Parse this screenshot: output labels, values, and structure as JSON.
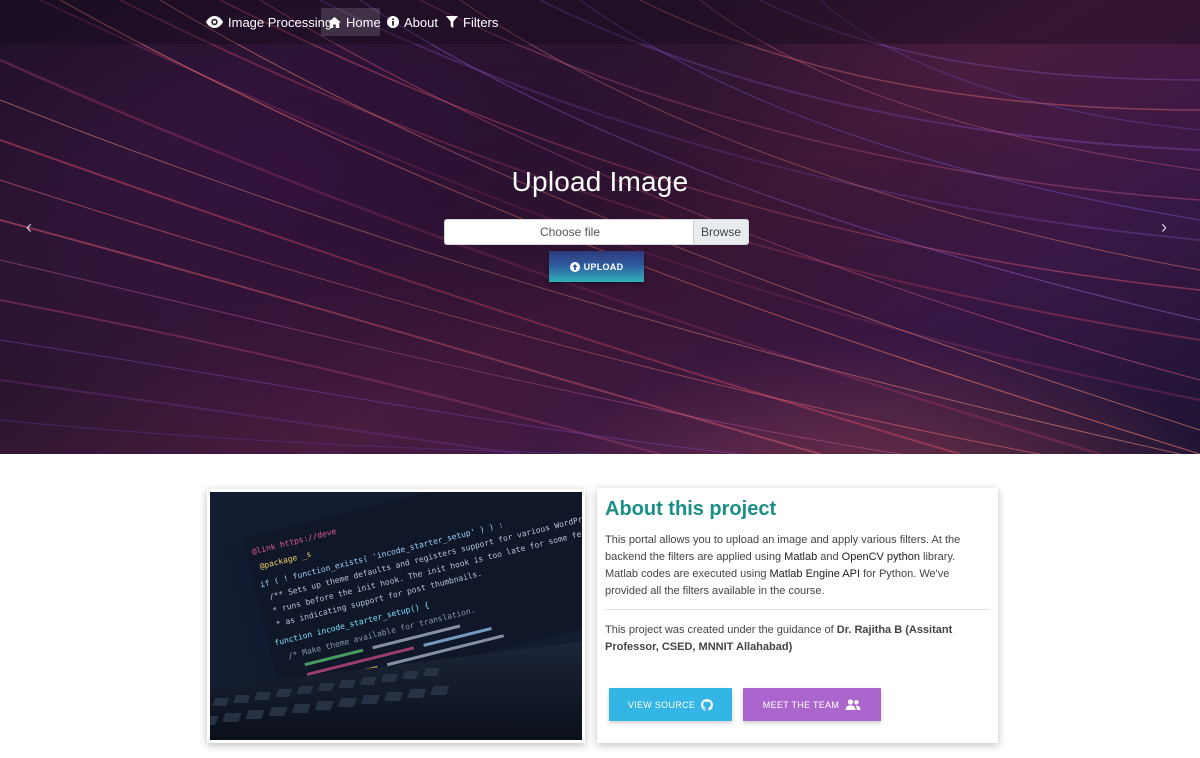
{
  "nav": {
    "brand": "Image Processing",
    "items": [
      {
        "label": "Home",
        "icon": "home-icon",
        "active": true
      },
      {
        "label": "About",
        "icon": "info-icon"
      },
      {
        "label": "Filters",
        "icon": "filter-icon"
      }
    ]
  },
  "hero": {
    "title": "Upload Image",
    "file_placeholder": "Choose file",
    "browse_label": "Browse",
    "upload_label": "UPLOAD"
  },
  "about": {
    "title": "About this project",
    "text": {
      "p1": "This portal allows you to upload an image and apply various filters. At the backend the filters are applied using ",
      "matlab": "Matlab",
      "and": " and ",
      "opencv": "OpenCV python",
      "p2": " library. Matlab codes are executed using ",
      "engine": "Matlab Engine API",
      "p3": " for Python. We've provided all the filters available in the course."
    },
    "guidance": {
      "p1": "This project was created under the guidance of ",
      "person": "Dr. Rajitha B (Assitant Professor, CSED, MNNIT Allahabad)"
    },
    "buttons": {
      "source": "VIEW SOURCE",
      "team": "MEET THE TEAM"
    }
  },
  "code_lines": [
    "@link https://deve",
    "@package _s",
    "if ( ! function_exists( 'incode_starter_setup' ) ) :",
    "/** Sets up theme defaults and registers support for various WordPress",
    " * runs before the init hook. The init hook is too late for some features",
    " * as indicating support for post thumbnails.",
    "function incode_starter_setup() {",
    " /* Make theme available for translation."
  ],
  "colors": {
    "accent": "#1a8f86",
    "source_button": "#33b5e5",
    "team_button": "#aa66cc"
  }
}
